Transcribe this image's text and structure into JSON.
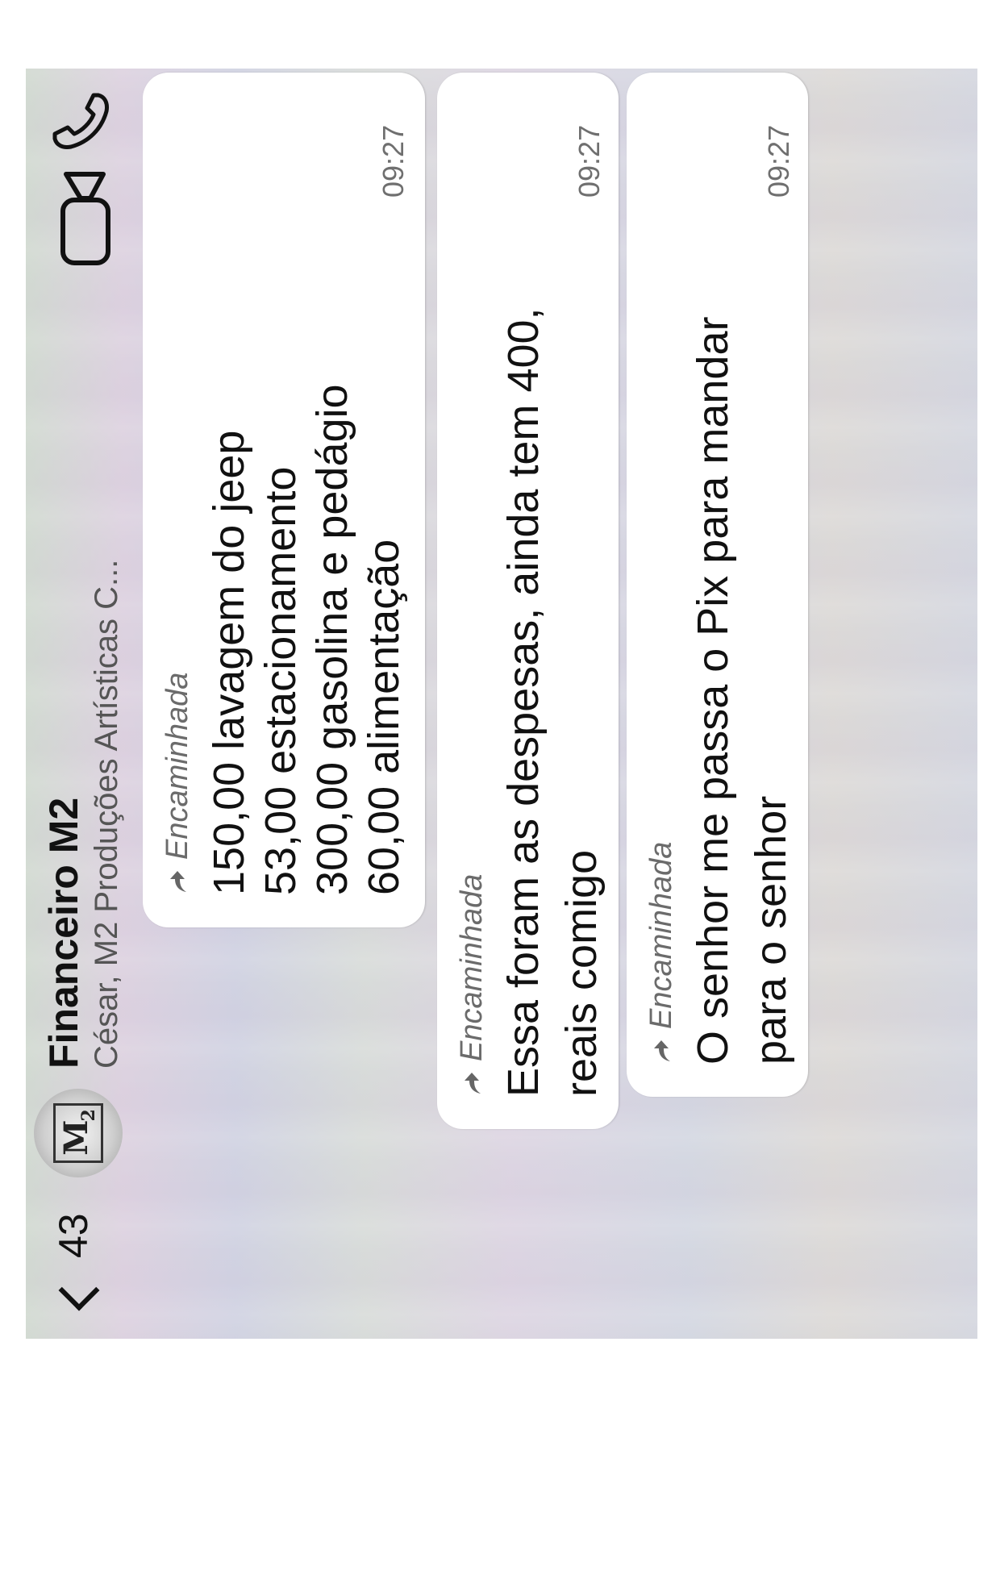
{
  "header": {
    "back_count": "43",
    "title": "Financeiro M2",
    "subtitle": "César, M2 Produções Artísticas C...",
    "avatar_text": "M",
    "avatar_sub": "2"
  },
  "messages": [
    {
      "forwarded_label": "Encaminhada",
      "lines": [
        "150,00 lavagem do jeep",
        "53,00 estacionamento",
        "300,00 gasolina e pedágio",
        "60,00 alimentação"
      ],
      "time": "09:27"
    },
    {
      "forwarded_label": "Encaminhada",
      "lines": [
        "Essa foram as despesas, ainda tem 400,",
        "reais comigo"
      ],
      "time": "09:27"
    },
    {
      "forwarded_label": "Encaminhada",
      "lines": [
        "O senhor me passa o Pix para mandar",
        "para o senhor"
      ],
      "time": "09:27"
    }
  ],
  "icons": {
    "back": "chevron-left-icon",
    "video": "video-call-icon",
    "phone": "phone-call-icon",
    "forward": "forward-arrow-icon"
  }
}
